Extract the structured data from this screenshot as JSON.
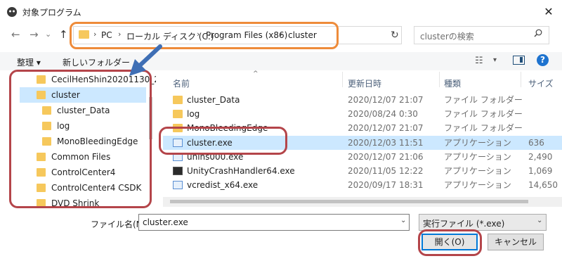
{
  "window": {
    "title": "対象プログラム",
    "close_glyph": "✕"
  },
  "nav": {
    "back": "←",
    "forward": "→",
    "recent": "⌄",
    "up": "↑",
    "breadcrumb": [
      "PC",
      "ローカル ディスク (C:)",
      "Program Files (x86)",
      "cluster"
    ],
    "separator": "›",
    "refresh": "↻",
    "search_placeholder": "clusterの検索"
  },
  "toolbar": {
    "organize": "整理 ▾",
    "new_folder": "新しいフォルダー",
    "view_icon": "☷",
    "view_caret": "▾",
    "help": "?"
  },
  "tree": {
    "items": [
      {
        "label": "CecilHenShin20201130_2",
        "indent": 0
      },
      {
        "label": "cluster",
        "indent": 0,
        "selected": true
      },
      {
        "label": "cluster_Data",
        "indent": 1
      },
      {
        "label": "log",
        "indent": 1
      },
      {
        "label": "MonoBleedingEdge",
        "indent": 1
      },
      {
        "label": "Common Files",
        "indent": 0
      },
      {
        "label": "ControlCenter4",
        "indent": 0
      },
      {
        "label": "ControlCenter4 CSDK",
        "indent": 0
      },
      {
        "label": "DVD Shrink",
        "indent": 0
      }
    ]
  },
  "columns": {
    "name": "名前",
    "date": "更新日時",
    "type": "種類",
    "size": "サイズ",
    "sort_glyph": "^"
  },
  "files": [
    {
      "name": "cluster_Data",
      "date": "2020/12/07 21:07",
      "type": "ファイル フォルダー",
      "size": "",
      "icon": "folder"
    },
    {
      "name": "log",
      "date": "2020/08/24 0:30",
      "type": "ファイル フォルダー",
      "size": "",
      "icon": "folder"
    },
    {
      "name": "MonoBleedingEdge",
      "date": "2020/12/07 21:07",
      "type": "ファイル フォルダー",
      "size": "",
      "icon": "folder"
    },
    {
      "name": "cluster.exe",
      "date": "2020/12/03 11:51",
      "type": "アプリケーション",
      "size": "636",
      "icon": "app",
      "selected": true
    },
    {
      "name": "unins000.exe",
      "date": "2020/12/07 21:06",
      "type": "アプリケーション",
      "size": "2,490",
      "icon": "app"
    },
    {
      "name": "UnityCrashHandler64.exe",
      "date": "2020/11/05 12:22",
      "type": "アプリケーション",
      "size": "1,069",
      "icon": "app-dark"
    },
    {
      "name": "vcredist_x64.exe",
      "date": "2020/09/17 18:31",
      "type": "アプリケーション",
      "size": "14,650",
      "icon": "app"
    }
  ],
  "bottom": {
    "filename_label": "ファイル名(N):",
    "filename_value": "cluster.exe",
    "filter_value": "実行ファイル (*.exe)",
    "caret": "⌄",
    "open": "開く(O)",
    "cancel": "キャンセル"
  },
  "colors": {
    "highlight_orange": "#ee8b3a",
    "highlight_red": "#b4454a",
    "arrow_blue": "#3f6fb5",
    "selection": "#cce8ff"
  }
}
